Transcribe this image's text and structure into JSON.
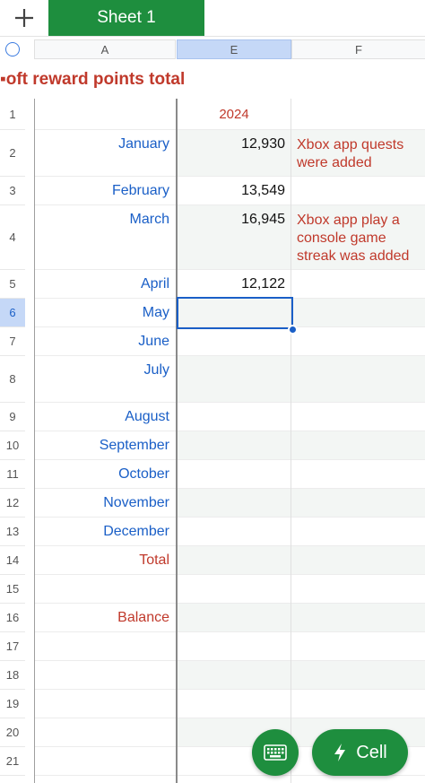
{
  "toolbar": {
    "sheet_tab": "Sheet 1",
    "add_icon": "plus-icon"
  },
  "columns": [
    "A",
    "E",
    "F"
  ],
  "title": "oft reward points total",
  "rows": [
    {
      "num": "1",
      "a": "",
      "e": "2024",
      "f": ""
    },
    {
      "num": "2",
      "a": "January",
      "e": "12,930",
      "f": "Xbox app quests were added"
    },
    {
      "num": "3",
      "a": "February",
      "e": "13,549",
      "f": ""
    },
    {
      "num": "4",
      "a": "March",
      "e": "16,945",
      "f": "Xbox app play a console game streak was added"
    },
    {
      "num": "5",
      "a": "April",
      "e": "12,122",
      "f": ""
    },
    {
      "num": "6",
      "a": "May",
      "e": "",
      "f": ""
    },
    {
      "num": "7",
      "a": "June",
      "e": "",
      "f": ""
    },
    {
      "num": "8",
      "a": "July",
      "e": "",
      "f": ""
    },
    {
      "num": "9",
      "a": "August",
      "e": "",
      "f": ""
    },
    {
      "num": "10",
      "a": "September",
      "e": "",
      "f": ""
    },
    {
      "num": "11",
      "a": "October",
      "e": "",
      "f": ""
    },
    {
      "num": "12",
      "a": "November",
      "e": "",
      "f": ""
    },
    {
      "num": "13",
      "a": "December",
      "e": "",
      "f": ""
    },
    {
      "num": "14",
      "a": "Total",
      "e": "",
      "f": ""
    },
    {
      "num": "15",
      "a": "",
      "e": "",
      "f": ""
    },
    {
      "num": "16",
      "a": "Balance",
      "e": "",
      "f": ""
    },
    {
      "num": "17",
      "a": "",
      "e": "",
      "f": ""
    },
    {
      "num": "18",
      "a": "",
      "e": "",
      "f": ""
    },
    {
      "num": "19",
      "a": "",
      "e": "",
      "f": ""
    },
    {
      "num": "20",
      "a": "",
      "e": "",
      "f": ""
    },
    {
      "num": "21",
      "a": "",
      "e": "",
      "f": ""
    }
  ],
  "buttons": {
    "keyboard_icon": "keyboard-icon",
    "cell_icon": "lightning-icon",
    "cell_label": "Cell"
  },
  "colors": {
    "accent_green": "#1e8e3e",
    "month_blue": "#1a5fc7",
    "note_red": "#c0392b",
    "selection_blue": "#1a5fc7"
  }
}
